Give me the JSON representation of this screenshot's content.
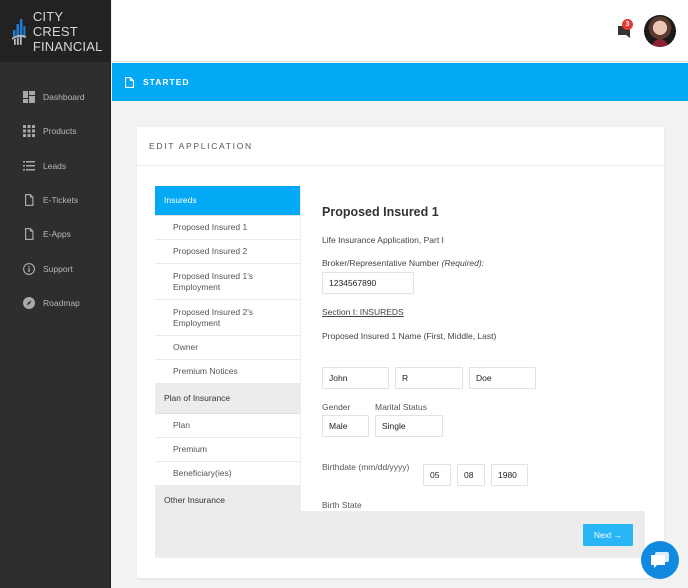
{
  "brand": {
    "line1": "CITY CREST",
    "line2": "FINANCIAL",
    "accent": "#03a9f4"
  },
  "sidebar": {
    "items": [
      {
        "label": "Dashboard",
        "icon": "dashboard-icon"
      },
      {
        "label": "Products",
        "icon": "grid-icon"
      },
      {
        "label": "Leads",
        "icon": "list-icon"
      },
      {
        "label": "E-Tickets",
        "icon": "document-icon"
      },
      {
        "label": "E-Apps",
        "icon": "document-icon"
      },
      {
        "label": "Support",
        "icon": "info-icon"
      },
      {
        "label": "Roadmap",
        "icon": "compass-icon"
      }
    ]
  },
  "header": {
    "notification_count": "3"
  },
  "status_bar": {
    "label": "STARTED"
  },
  "card": {
    "title": "EDIT APPLICATION"
  },
  "steps": [
    {
      "label": "Insureds",
      "type": "group",
      "active": true
    },
    {
      "label": "Proposed Insured 1",
      "type": "item"
    },
    {
      "label": "Proposed Insured 2",
      "type": "item"
    },
    {
      "label": "Proposed Insured 1's Employment",
      "type": "item"
    },
    {
      "label": "Proposed Insured 2's Employment",
      "type": "item"
    },
    {
      "label": "Owner",
      "type": "item"
    },
    {
      "label": "Premium Notices",
      "type": "item"
    },
    {
      "label": "Plan of Insurance",
      "type": "group"
    },
    {
      "label": "Plan",
      "type": "item"
    },
    {
      "label": "Premium",
      "type": "item"
    },
    {
      "label": "Beneficiary(ies)",
      "type": "item"
    },
    {
      "label": "Other Insurance",
      "type": "group"
    }
  ],
  "form": {
    "title": "Proposed Insured 1",
    "subtitle": "Life Insurance Application, Part I",
    "broker_label": "Broker/Representative Number ",
    "broker_required": "(Required):",
    "broker_value": "1234567890",
    "section_label": "Section I: INSUREDS",
    "name_label": "Proposed Insured 1 Name (First, Middle, Last)",
    "first_name": "John",
    "middle_name": "R",
    "last_name": "Doe",
    "gender_label": "Gender",
    "gender_value": "Male",
    "marital_label": "Marital Status",
    "marital_value": "Single",
    "birthdate_label": "Birthdate (mm/dd/yyyy)",
    "birth_month": "05",
    "birth_day": "08",
    "birth_year": "1980",
    "birth_state_label": "Birth State"
  },
  "footer": {
    "next_label": "Next →"
  }
}
